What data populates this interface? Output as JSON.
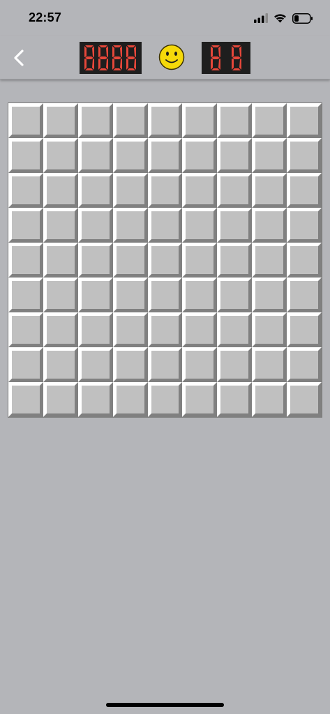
{
  "status": {
    "time": "22:57"
  },
  "toolbar": {
    "mine_counter_digits": [
      "8",
      "8",
      "8",
      "8"
    ],
    "timer_digits": [
      "8",
      "8"
    ],
    "smiley_face": "smiley-face-icon"
  },
  "board": {
    "rows": 9,
    "cols": 9,
    "cell_state": "unrevealed"
  },
  "colors": {
    "background": "#b4b5b9",
    "cell_face": "#c0c0c0",
    "cell_highlight": "#ffffff",
    "cell_shadow": "#808080",
    "led_on": "#e6473a",
    "led_off": "#4a1c18",
    "counter_bg": "#1e1e1e",
    "smiley": "#f5d90a"
  }
}
